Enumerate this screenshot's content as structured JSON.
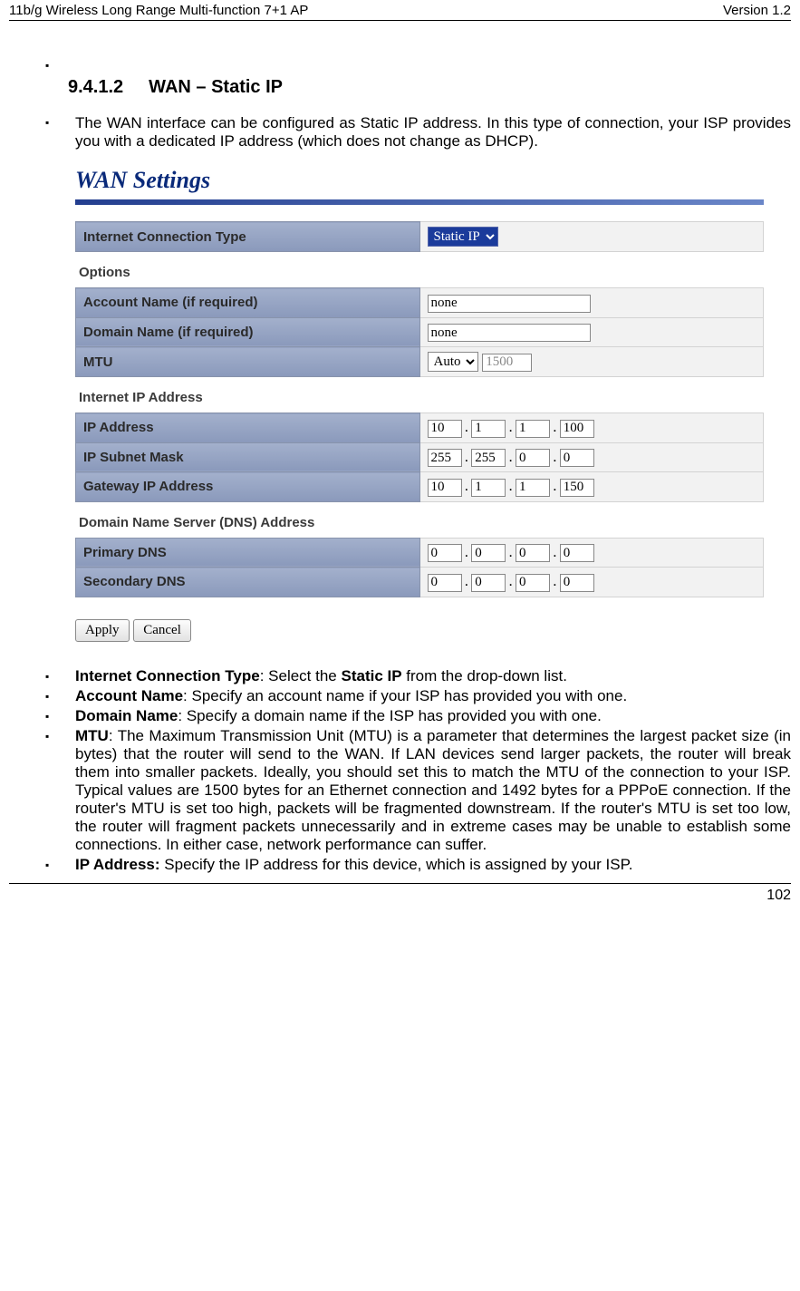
{
  "header": {
    "left": "11b/g Wireless Long Range Multi-function 7+1 AP",
    "right": "Version 1.2"
  },
  "footer": {
    "page": "102"
  },
  "heading": {
    "num": "9.4.1.2",
    "title": "WAN – Static IP"
  },
  "intro": "The WAN interface can be configured as Static IP address. In this type of connection, your ISP provides you with a dedicated IP address (which does not change as DHCP).",
  "panel": {
    "title": "WAN Settings",
    "conn": {
      "label": "Internet Connection Type",
      "value": "Static IP"
    },
    "optionsHead": "Options",
    "account": {
      "label": "Account Name (if required)",
      "value": "none"
    },
    "domain": {
      "label": "Domain Name (if required)",
      "value": "none"
    },
    "mtu": {
      "label": "MTU",
      "mode": "Auto",
      "value": "1500"
    },
    "ipHead": "Internet IP Address",
    "ip": {
      "label": "IP Address",
      "o": [
        "10",
        "1",
        "1",
        "100"
      ]
    },
    "mask": {
      "label": "IP Subnet Mask",
      "o": [
        "255",
        "255",
        "0",
        "0"
      ]
    },
    "gw": {
      "label": "Gateway IP Address",
      "o": [
        "10",
        "1",
        "1",
        "150"
      ]
    },
    "dnsHead": "Domain Name Server (DNS) Address",
    "pdns": {
      "label": "Primary DNS",
      "o": [
        "0",
        "0",
        "0",
        "0"
      ]
    },
    "sdns": {
      "label": "Secondary DNS",
      "o": [
        "0",
        "0",
        "0",
        "0"
      ]
    },
    "apply": "Apply",
    "cancel": "Cancel"
  },
  "notes": {
    "ict": {
      "b": "Internet Connection Type",
      "t": ": Select the ",
      "b2": "Static IP",
      "t2": " from the drop-down list."
    },
    "acct": {
      "b": "Account Name",
      "t": ": Specify an account name if your ISP has provided you with one."
    },
    "dom": {
      "b": "Domain Name",
      "t": ": Specify a domain name if the ISP has provided you with one."
    },
    "mtu": {
      "b": "MTU",
      "t": ": The Maximum Transmission Unit (MTU) is a parameter that determines the largest packet size (in bytes) that the router will send to the WAN. If LAN devices send larger packets, the router will break them into smaller packets. Ideally, you should set this to match the MTU of the connection to your ISP. Typical values are 1500 bytes for an Ethernet connection and 1492 bytes for a PPPoE connection. If the router's MTU is set too high, packets will be fragmented downstream. If the router's MTU is set too low, the router will fragment packets unnecessarily and in extreme cases may be unable to establish some connections. In either case, network performance can suffer."
    },
    "ipaddr": {
      "b": "IP Address:",
      "t": " Specify the IP address for this device, which is assigned by your ISP."
    }
  }
}
